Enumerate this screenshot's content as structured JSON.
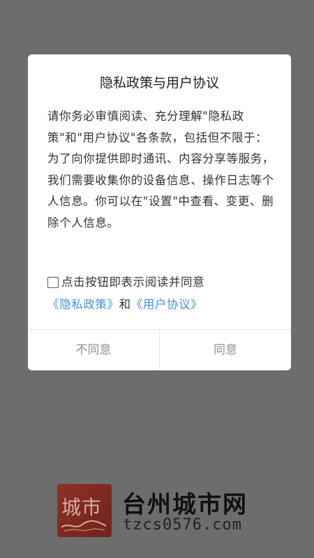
{
  "dialog": {
    "title": "隐私政策与用户协议",
    "body": "请你务必审慎阅读、充分理解\"隐私政策\"和\"用户协议\"各条款，包括但不限于：为了向你提供即时通讯、内容分享等服务，我们需要收集你的设备信息、操作日志等个人信息。你可以在\"设置\"中查看、变更、删除个人信息。",
    "consent": {
      "prefix": "点击按钮即表示阅读并同意",
      "privacy_link": "《隐私政策》",
      "and_text": "和",
      "terms_link": "《用户协议》",
      "checked": false
    },
    "buttons": {
      "disagree": "不同意",
      "agree": "同意"
    }
  },
  "brand": {
    "logo_char": "城市",
    "name": "台州城市网",
    "url": "tzcs0576.com"
  },
  "colors": {
    "overlay": "#6d6d6d",
    "link": "#4a8fd6",
    "logo": "#7a2a20"
  }
}
